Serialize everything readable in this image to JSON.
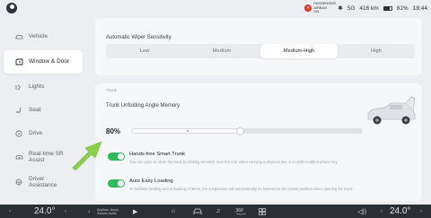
{
  "status": {
    "airbag_label": "PASSENGER AIRBAG ON",
    "signal": "5G",
    "range": "416 km",
    "battery": "81%",
    "time": "18:44"
  },
  "sidebar": {
    "items": [
      {
        "label": "Vehicle",
        "icon": "car-icon"
      },
      {
        "label": "Window & Door",
        "icon": "door-icon",
        "active": true
      },
      {
        "label": "Lights",
        "icon": "lights-icon"
      },
      {
        "label": "Seat",
        "icon": "seat-icon"
      },
      {
        "label": "Drive",
        "icon": "steering-icon"
      },
      {
        "label": "Real-time SR Assist",
        "icon": "sr-assist-icon"
      },
      {
        "label": "Driver Assistance",
        "icon": "assist-icon"
      }
    ]
  },
  "wiper": {
    "title": "Automatic Wiper Sensitivity",
    "options": [
      "Low",
      "Medium",
      "Medium-High",
      "High"
    ],
    "selected": "Medium-High"
  },
  "trunk": {
    "section_label": "Trunk",
    "angle_title": "Trunk Unfolding Angle Memory",
    "angle_value": "80%",
    "angle_fraction": 0.8,
    "handsfree_title": "Hands-free Smart Trunk",
    "handsfree_desc": "You can open or close the trunk by kicking remotely near the rear when carrying a physical key or a UWB-enabled phone key",
    "handsfree_on": true,
    "autoload_title": "Auto Easy Loading",
    "autoload_desc": "To facilitate loading and unloading of items, the suspension will automatically be lowered to the lowest position when opening the trunk",
    "autoload_on": true
  },
  "dock": {
    "left_temp": "24.0°",
    "right_temp": "24.0°",
    "media_line1": "Anytime, Anyw...",
    "media_line2": "Senses Audio"
  },
  "colors": {
    "toggle_on": "#2fb85c",
    "arrow": "#8bcf4a",
    "dock_bg": "#2b2e33"
  }
}
